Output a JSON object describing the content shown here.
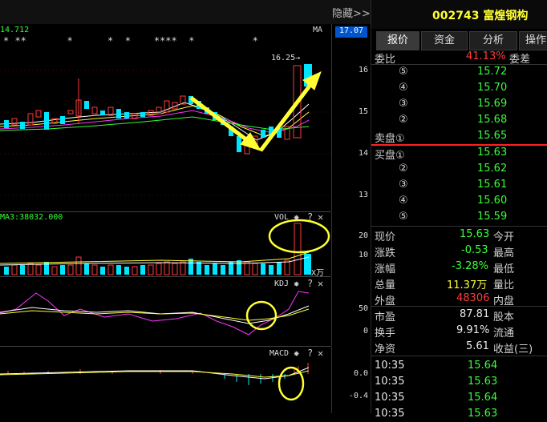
{
  "top_bar": {
    "hide_label": "隐藏>>",
    "stock_title": "002743 富煌钢构"
  },
  "main_chart": {
    "ma_label": "14.712",
    "ma_tag": "MA",
    "price_badge": "17.07",
    "high_label": "16.25→",
    "axis_labels": [
      "16",
      "15",
      "14",
      "13"
    ],
    "star_marks": "* **       *      *  *    ****  *          *"
  },
  "vol_chart": {
    "header": "MA3:38032.000",
    "tag": "VOL",
    "axis_labels": [
      "20",
      "10"
    ],
    "unit": "X万"
  },
  "kdj_chart": {
    "tag": "KDJ",
    "axis_labels": [
      "50",
      "0"
    ]
  },
  "macd_chart": {
    "tag": "MACD",
    "axis_labels": [
      "0.0",
      "-0.4"
    ]
  },
  "tabs": [
    "报价",
    "资金",
    "分析",
    "操作"
  ],
  "quote": {
    "weibi_label": "委比",
    "weibi_value": "41.13%",
    "weicha_label": "委差",
    "asks": [
      {
        "level": "⑤",
        "price": "15.72"
      },
      {
        "level": "④",
        "price": "15.70"
      },
      {
        "level": "③",
        "price": "15.69"
      },
      {
        "level": "②",
        "price": "15.68"
      },
      {
        "level": "卖盘①",
        "price": "15.65"
      }
    ],
    "bids": [
      {
        "level": "买盘①",
        "price": "15.63"
      },
      {
        "level": "②",
        "price": "15.62"
      },
      {
        "level": "③",
        "price": "15.61"
      },
      {
        "level": "④",
        "price": "15.60"
      },
      {
        "level": "⑤",
        "price": "15.59"
      }
    ],
    "stats": [
      {
        "label": "现价",
        "value": "15.63",
        "label2": "今开"
      },
      {
        "label": "涨跌",
        "value": "-0.53",
        "label2": "最高"
      },
      {
        "label": "涨幅",
        "value": "-3.28%",
        "label2": "最低"
      },
      {
        "label": "总量",
        "value": "11.37万",
        "label2": "量比"
      },
      {
        "label": "外盘",
        "value": "48306",
        "label2": "内盘"
      },
      {
        "label": "市盈",
        "value": "87.81",
        "label2": "股本"
      },
      {
        "label": "换手",
        "value": "9.91%",
        "label2": "流通"
      },
      {
        "label": "净资",
        "value": "5.61",
        "label2": "收益(三)"
      }
    ],
    "ticks": [
      {
        "time": "10:35",
        "price": "15.64"
      },
      {
        "time": "10:35",
        "price": "15.63"
      },
      {
        "time": "10:35",
        "price": "15.64"
      },
      {
        "time": "10:35",
        "price": "15.63"
      }
    ]
  },
  "colors": {
    "up": "#ff3b3b",
    "down": "#00e5ff",
    "annotation": "#ffff33"
  }
}
